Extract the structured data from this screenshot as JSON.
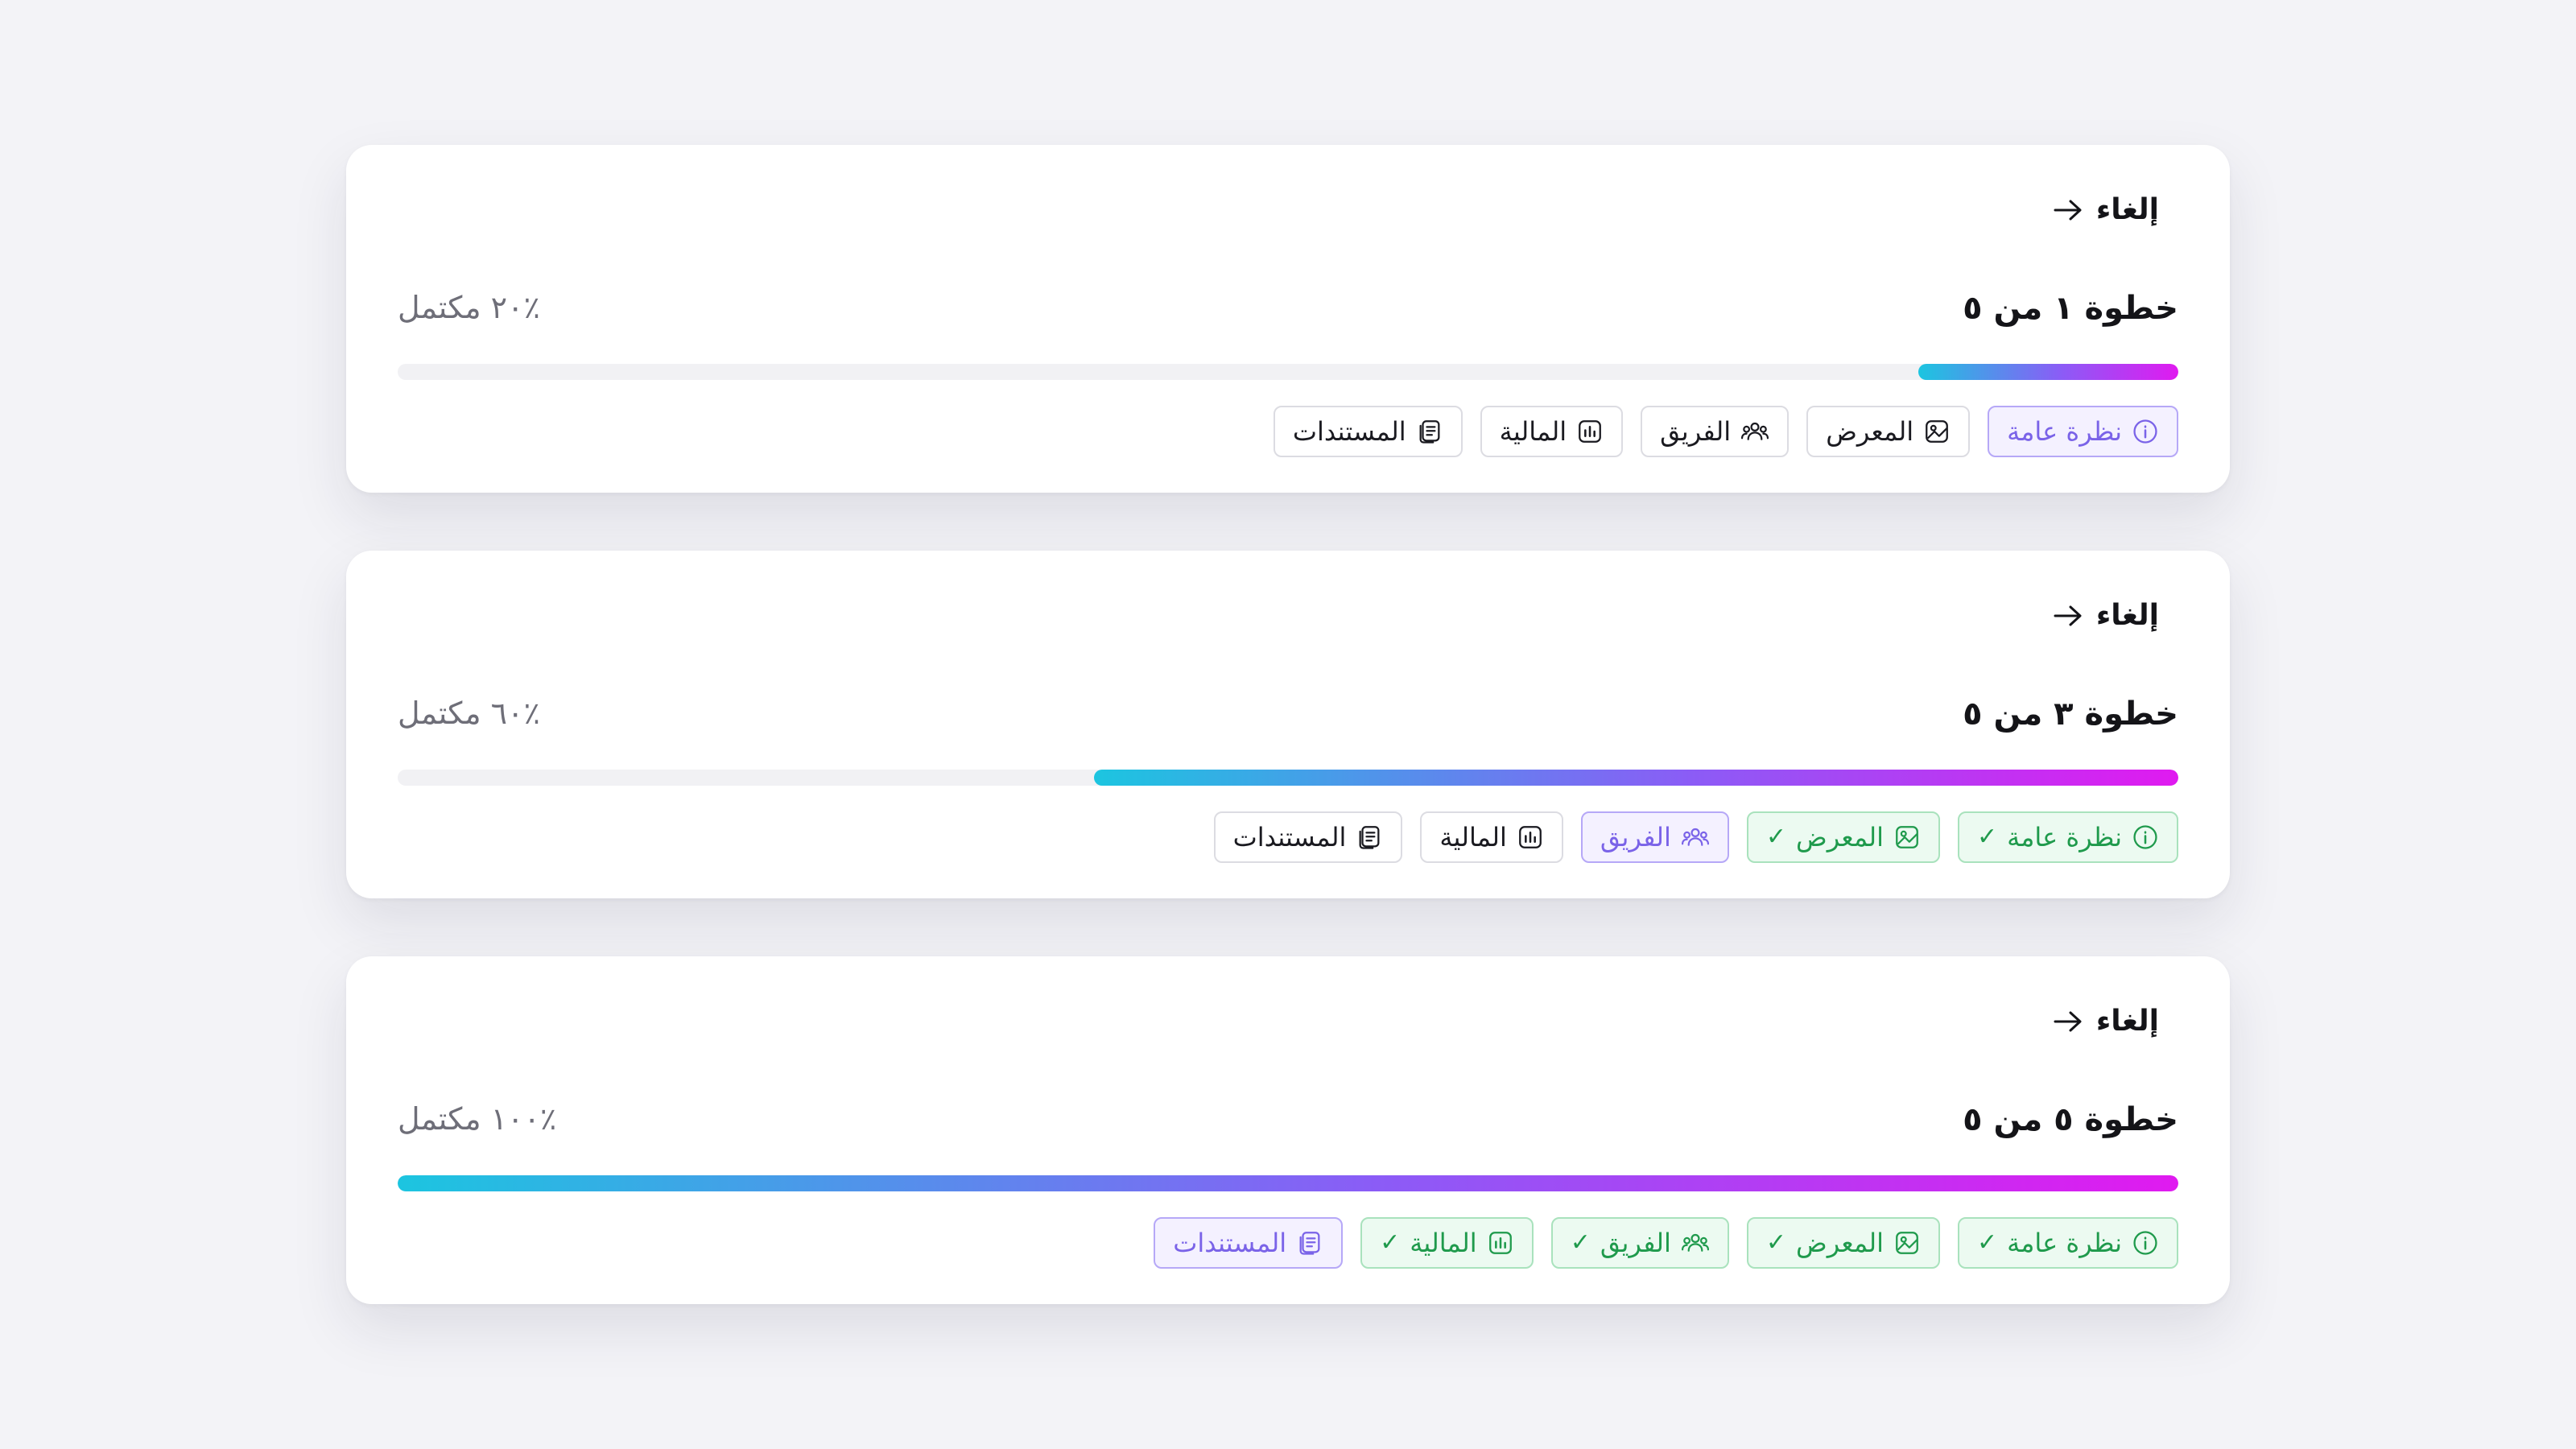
{
  "cards": [
    {
      "cancel_label": "إلغاء",
      "step_label": "خطوة ١ من ٥",
      "percent_label": "٪٢٠ مكتمل",
      "progress": 0.146,
      "tabs": [
        {
          "label": "نظرة عامة",
          "icon": "info-icon",
          "state": "active"
        },
        {
          "label": "المعرض",
          "icon": "gallery-icon",
          "state": "todo"
        },
        {
          "label": "الفريق",
          "icon": "team-icon",
          "state": "todo"
        },
        {
          "label": "المالية",
          "icon": "chart-icon",
          "state": "todo"
        },
        {
          "label": "المستندات",
          "icon": "documents-icon",
          "state": "todo"
        }
      ]
    },
    {
      "cancel_label": "إلغاء",
      "step_label": "خطوة ٣ من ٥",
      "percent_label": "٪٦٠ مكتمل",
      "progress": 0.609,
      "tabs": [
        {
          "label": "نظرة عامة",
          "icon": "info-icon",
          "state": "done"
        },
        {
          "label": "المعرض",
          "icon": "gallery-icon",
          "state": "done"
        },
        {
          "label": "الفريق",
          "icon": "team-icon",
          "state": "active"
        },
        {
          "label": "المالية",
          "icon": "chart-icon",
          "state": "todo"
        },
        {
          "label": "المستندات",
          "icon": "documents-icon",
          "state": "todo"
        }
      ]
    },
    {
      "cancel_label": "إلغاء",
      "step_label": "خطوة ٥ من ٥",
      "percent_label": "٪١٠٠ مكتمل",
      "progress": 1.0,
      "tabs": [
        {
          "label": "نظرة عامة",
          "icon": "info-icon",
          "state": "done"
        },
        {
          "label": "المعرض",
          "icon": "gallery-icon",
          "state": "done"
        },
        {
          "label": "الفريق",
          "icon": "team-icon",
          "state": "done"
        },
        {
          "label": "المالية",
          "icon": "chart-icon",
          "state": "done"
        },
        {
          "label": "المستندات",
          "icon": "documents-icon",
          "state": "active"
        }
      ]
    }
  ],
  "colors": {
    "accent_purple": "#7a63e8",
    "done_green": "#1f9a4c",
    "gradient_start": "#1cc5e0",
    "gradient_end": "#e01af0"
  }
}
